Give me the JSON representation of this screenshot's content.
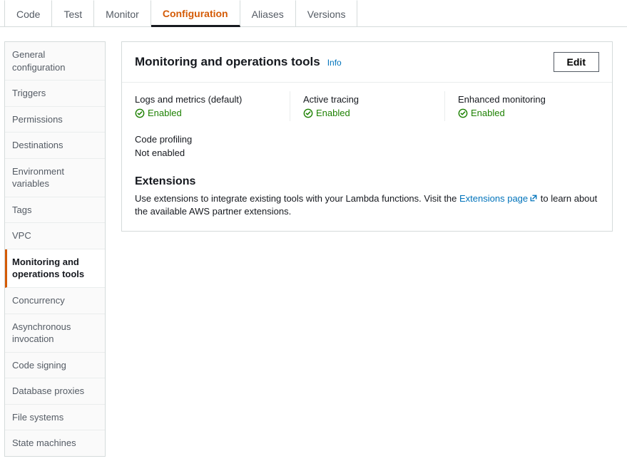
{
  "tabs": {
    "code": "Code",
    "test": "Test",
    "monitor": "Monitor",
    "configuration": "Configuration",
    "aliases": "Aliases",
    "versions": "Versions"
  },
  "sidebar": {
    "general": "General configuration",
    "triggers": "Triggers",
    "permissions": "Permissions",
    "destinations": "Destinations",
    "env": "Environment variables",
    "tags": "Tags",
    "vpc": "VPC",
    "monitoring": "Monitoring and operations tools",
    "concurrency": "Concurrency",
    "async": "Asynchronous invocation",
    "signing": "Code signing",
    "dbproxies": "Database proxies",
    "filesystems": "File systems",
    "statemachines": "State machines"
  },
  "panel": {
    "title": "Monitoring and operations tools",
    "info": "Info",
    "edit": "Edit"
  },
  "status": {
    "logs": {
      "label": "Logs and metrics (default)",
      "value": "Enabled"
    },
    "tracing": {
      "label": "Active tracing",
      "value": "Enabled"
    },
    "enhanced": {
      "label": "Enhanced monitoring",
      "value": "Enabled"
    },
    "profiling": {
      "label": "Code profiling",
      "value": "Not enabled"
    }
  },
  "extensions": {
    "title": "Extensions",
    "pre": "Use extensions to integrate existing tools with your Lambda functions. Visit the ",
    "link": "Extensions page",
    "post": " to learn about the available AWS partner extensions."
  },
  "colors": {
    "accent": "#d45b07",
    "link": "#0073bb",
    "success": "#1d8102"
  }
}
